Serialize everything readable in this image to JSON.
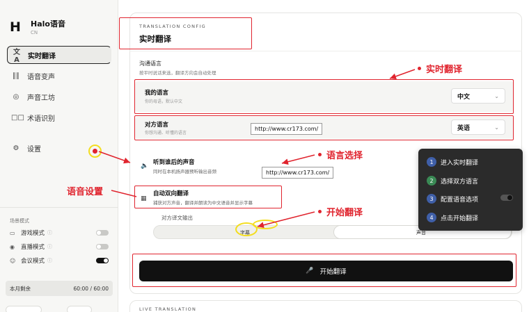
{
  "brand": {
    "logo": "H",
    "name": "Halo语音",
    "sub": "CN"
  },
  "nav": [
    {
      "label": "实时翻译",
      "icon": "translate-icon",
      "glyph": "文A",
      "active": true
    },
    {
      "label": "语音变声",
      "icon": "waveform-icon",
      "glyph": "∥∥",
      "active": false
    },
    {
      "label": "声音工坊",
      "icon": "broadcast-icon",
      "glyph": "◎",
      "active": false
    },
    {
      "label": "术语识别",
      "icon": "book-icon",
      "glyph": "□□",
      "active": false
    },
    {
      "label": "设置",
      "icon": "gear-icon",
      "glyph": "⚙",
      "active": false
    }
  ],
  "modes": {
    "label": "场景模式",
    "items": [
      {
        "label": "游戏模式",
        "icon": "gamepad-icon",
        "glyph": "▭",
        "on": false
      },
      {
        "label": "直播模式",
        "icon": "live-icon",
        "glyph": "◉",
        "on": false
      },
      {
        "label": "会议模式",
        "icon": "people-icon",
        "glyph": "☺",
        "on": true
      }
    ]
  },
  "usage": {
    "label": "本月剩余",
    "value": "60:00 / 60:00"
  },
  "config": {
    "eyebrow": "TRANSLATION CONFIG",
    "title": "实时翻译",
    "lang_head": "沟通语言",
    "lang_desc": "按平时说话来选，翻译方向会自动处理",
    "my_lang": {
      "title": "我的语言",
      "sub": "你的母语，默认中文",
      "value": "中文"
    },
    "other_lang": {
      "title": "对方语言",
      "sub": "你想沟通、听懂的语言",
      "value": "英语"
    },
    "hear_after": {
      "title": "听到谁后的声音",
      "desc": "同时在本机扬声器预听输出音频"
    },
    "auto_bi": {
      "title": "自动双向翻译",
      "desc": "捕获对方声音，翻译并朗读为中文语音并显示字幕"
    },
    "output": {
      "label": "对方译文输出",
      "left": "字幕",
      "right": "声音"
    },
    "start_label": "开始翻译",
    "live_label": "LIVE TRANSLATION"
  },
  "watermark_url": "http://www.cr173.com/",
  "annotations": {
    "realtime": "实时翻译",
    "lang_select": "语言选择",
    "start": "开始翻译",
    "voice_settings": "语音设置"
  },
  "steps": [
    {
      "num": "1",
      "label": "进入实时翻译",
      "color": "#3f5fa8"
    },
    {
      "num": "2",
      "label": "选择双方语言",
      "color": "#3a8a55"
    },
    {
      "num": "3",
      "label": "配置语音选项",
      "color": "#3f5fa8"
    },
    {
      "num": "4",
      "label": "点击开始翻译",
      "color": "#3f5fa8"
    }
  ],
  "colors": {
    "annotation_red": "#e0242e",
    "highlight_yellow": "#f3dd1f",
    "primary_black": "#111111"
  }
}
